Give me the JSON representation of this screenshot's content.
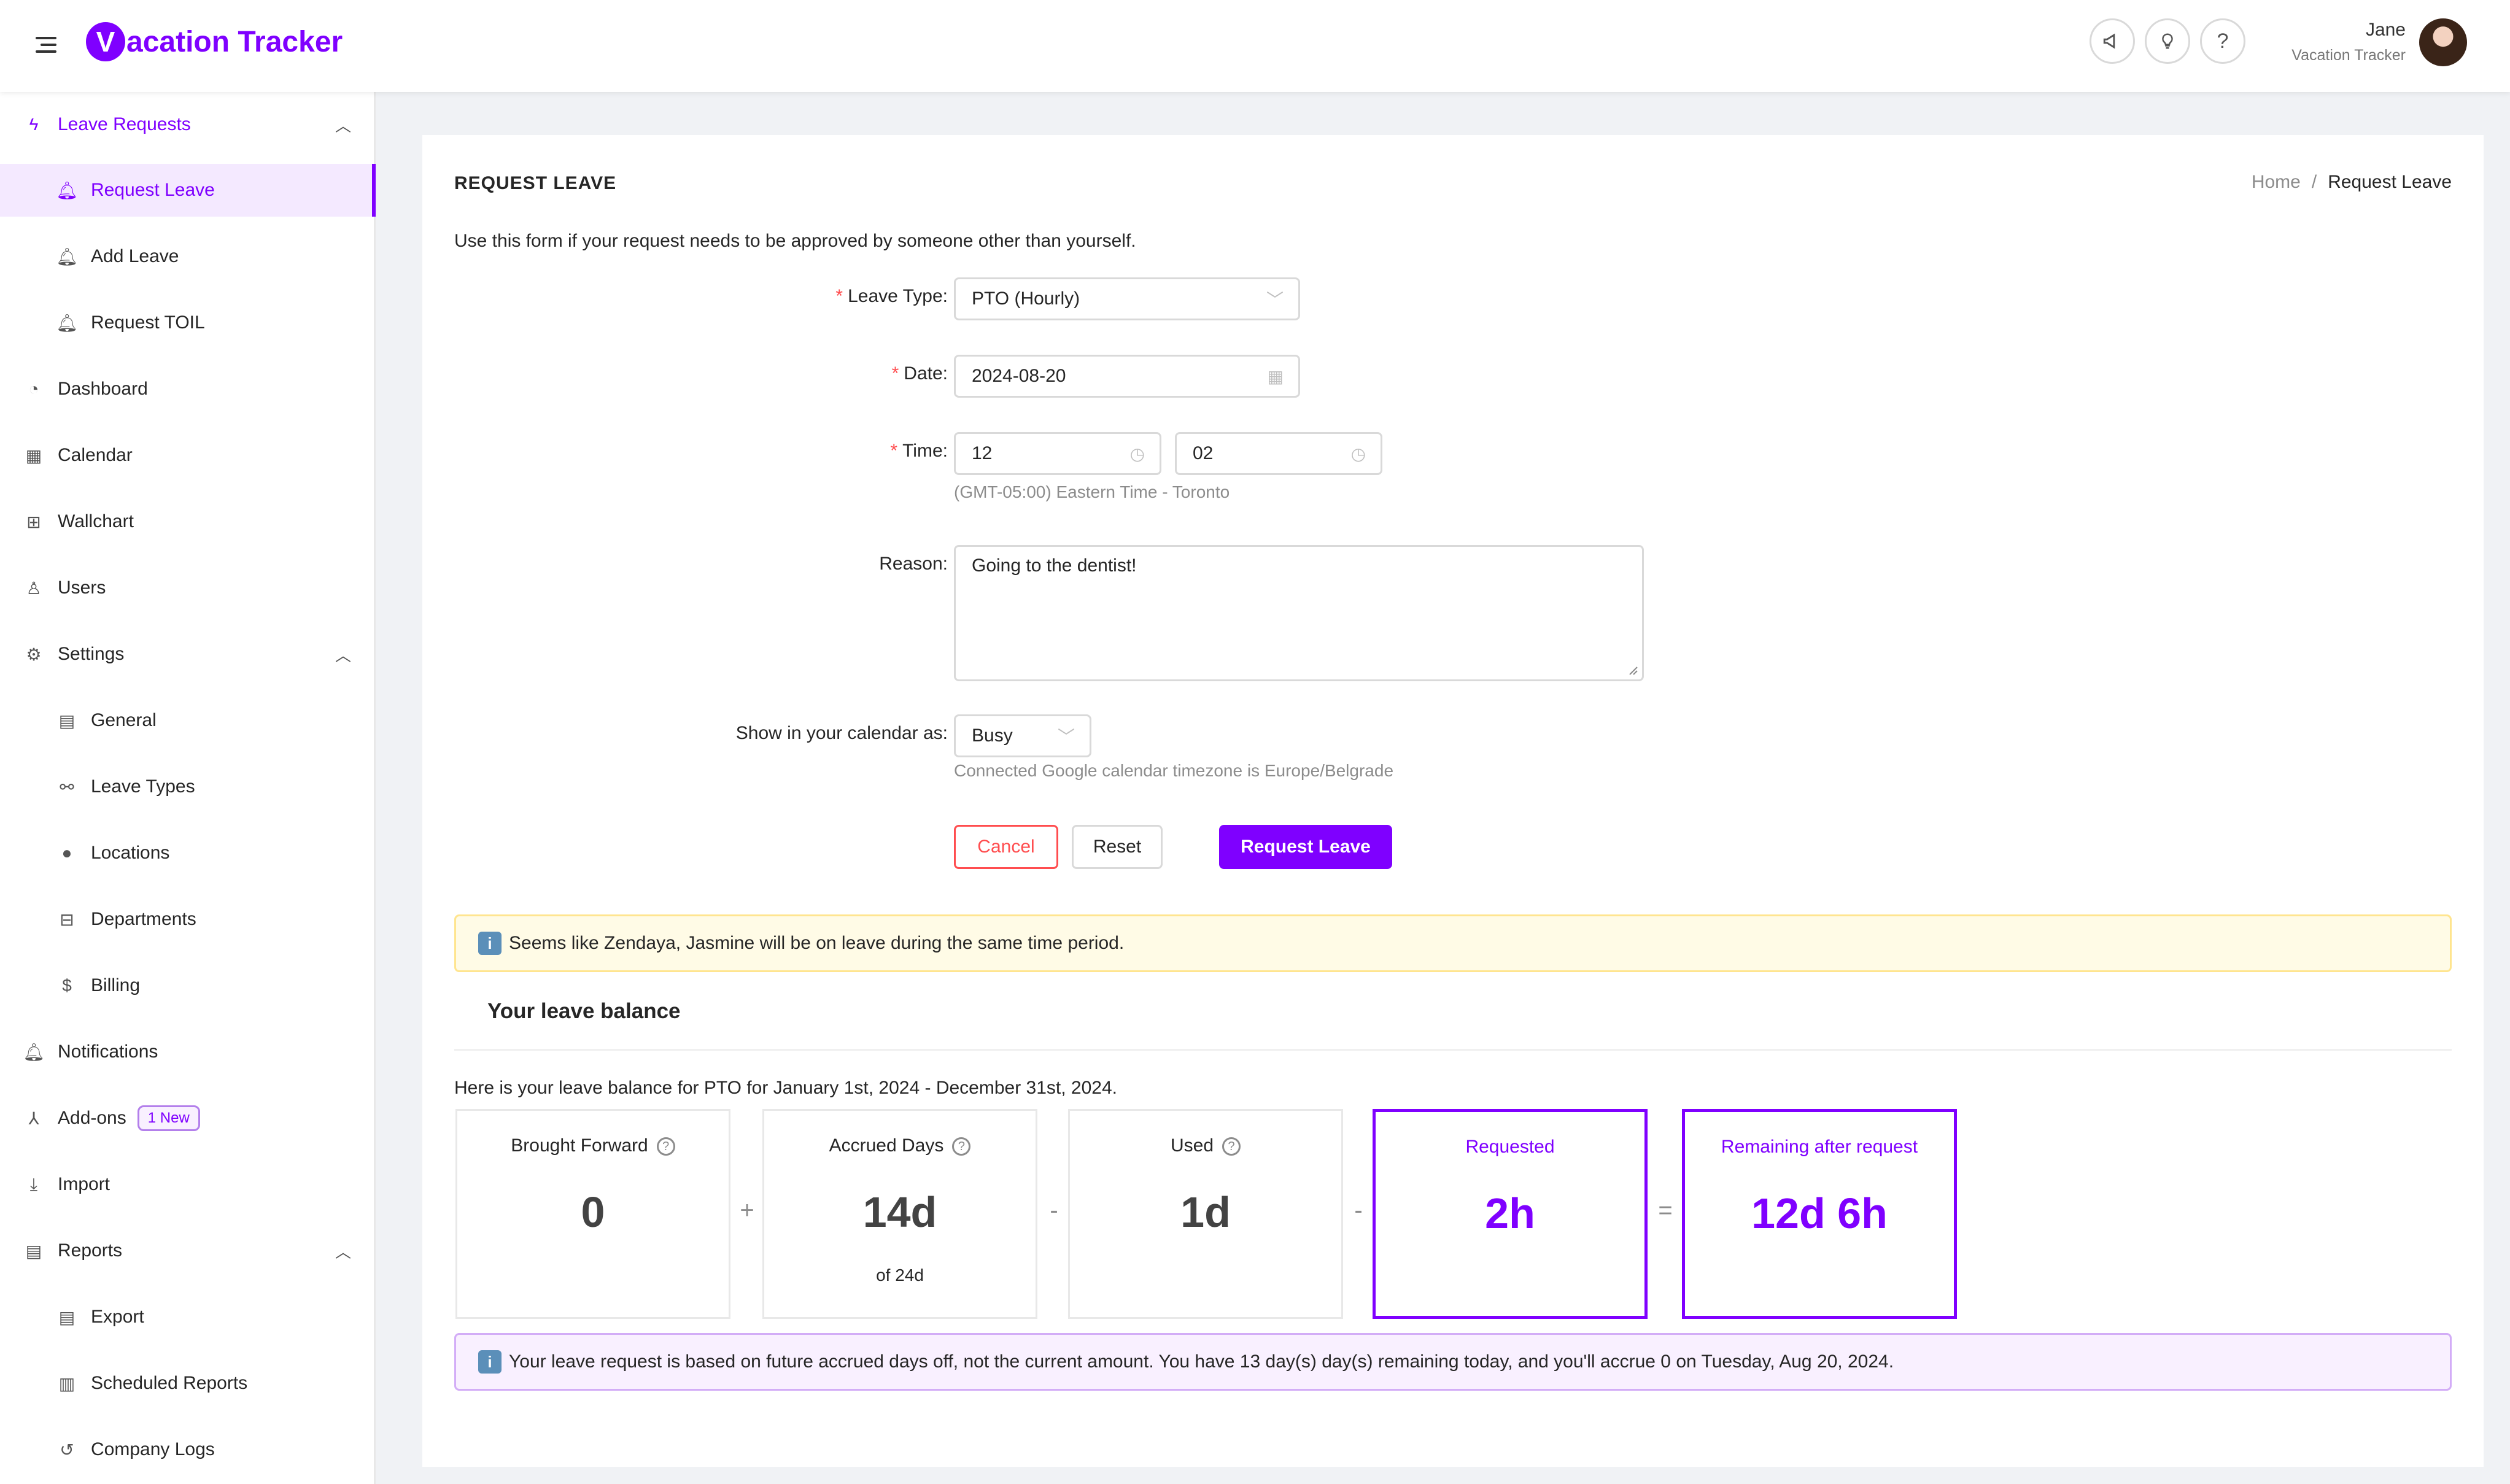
{
  "header": {
    "logo_letter": "V",
    "logo_text": "acation Tracker",
    "user_name": "Jane",
    "user_company": "Vacation Tracker",
    "icons": [
      "megaphone-icon",
      "lightbulb-icon",
      "help-icon"
    ]
  },
  "sidebar": {
    "leave_requests": "Leave Requests",
    "request_leave": "Request Leave",
    "add_leave": "Add Leave",
    "request_toil": "Request TOIL",
    "dashboard": "Dashboard",
    "calendar": "Calendar",
    "wallchart": "Wallchart",
    "users": "Users",
    "settings": "Settings",
    "general": "General",
    "leave_types": "Leave Types",
    "locations": "Locations",
    "departments": "Departments",
    "billing": "Billing",
    "notifications": "Notifications",
    "addons": "Add-ons",
    "addons_badge": "1 New",
    "import": "Import",
    "reports": "Reports",
    "export": "Export",
    "scheduled_reports": "Scheduled Reports",
    "company_logs": "Company Logs"
  },
  "page": {
    "title": "REQUEST LEAVE",
    "breadcrumb_home": "Home",
    "breadcrumb_sep": "/",
    "breadcrumb_current": "Request Leave",
    "intro": "Use this form if your request needs to be approved by someone other than yourself."
  },
  "form": {
    "required_mark": "*",
    "leave_type_label": "Leave Type",
    "leave_type_value": "PTO (Hourly)",
    "date_label": "Date",
    "date_value": "2024-08-20",
    "time_label": "Time",
    "time_start": "12",
    "time_end": "02",
    "timezone_hint": "(GMT-05:00) Eastern Time - Toronto",
    "reason_label": "Reason",
    "reason_value": "Going to the dentist!",
    "calendar_label": "Show in your calendar as",
    "calendar_value": "Busy",
    "calendar_hint": "Connected Google calendar timezone is Europe/Belgrade",
    "cancel": "Cancel",
    "reset": "Reset",
    "submit": "Request Leave"
  },
  "alerts": {
    "overlap": "Seems like Zendaya, Jasmine will be on leave during the same time period.",
    "accrual": "Your leave request is based on future accrued days off, not the current amount. You have 13 day(s) day(s) remaining today, and you'll accrue 0 on Tuesday, Aug 20, 2024."
  },
  "balance": {
    "title": "Your leave balance",
    "intro": "Here is your leave balance for PTO for January 1st, 2024 - December 31st, 2024.",
    "brought_forward_label": "Brought Forward",
    "brought_forward_value": "0",
    "accrued_label": "Accrued Days",
    "accrued_value": "14d",
    "accrued_sub": "of 24d",
    "used_label": "Used",
    "used_value": "1d",
    "requested_label": "Requested",
    "requested_value": "2h",
    "remaining_label": "Remaining after request",
    "remaining_value": "12d 6h",
    "op_plus": "+",
    "op_minus": "-",
    "op_equals": "="
  },
  "colors": {
    "accent": "#7f00ff",
    "danger": "#ff4d4f",
    "warn_bg": "#fffbe6",
    "info_bg": "#f9f0ff"
  }
}
